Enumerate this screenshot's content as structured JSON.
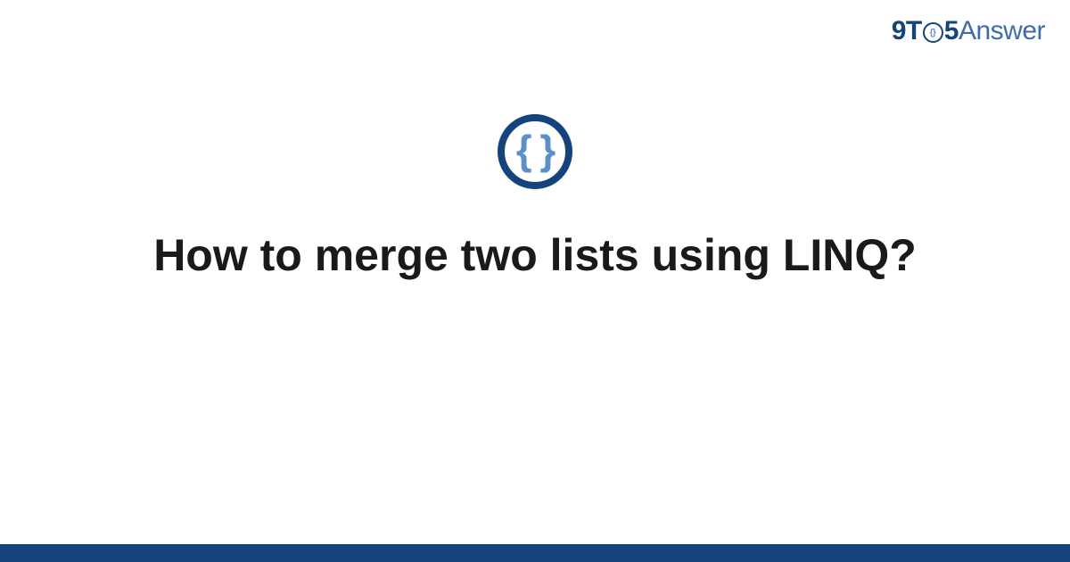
{
  "brand": {
    "part1": "9T",
    "part2": "5",
    "part3": "Answer",
    "icon_name": "braces-icon"
  },
  "topic_icon": {
    "name": "code-braces-icon",
    "glyph": "{ }"
  },
  "title": "How to merge two lists using LINQ?",
  "colors": {
    "primary": "#15447c",
    "accent": "#5d8fc9",
    "logo_answer": "#3d6ca8"
  }
}
